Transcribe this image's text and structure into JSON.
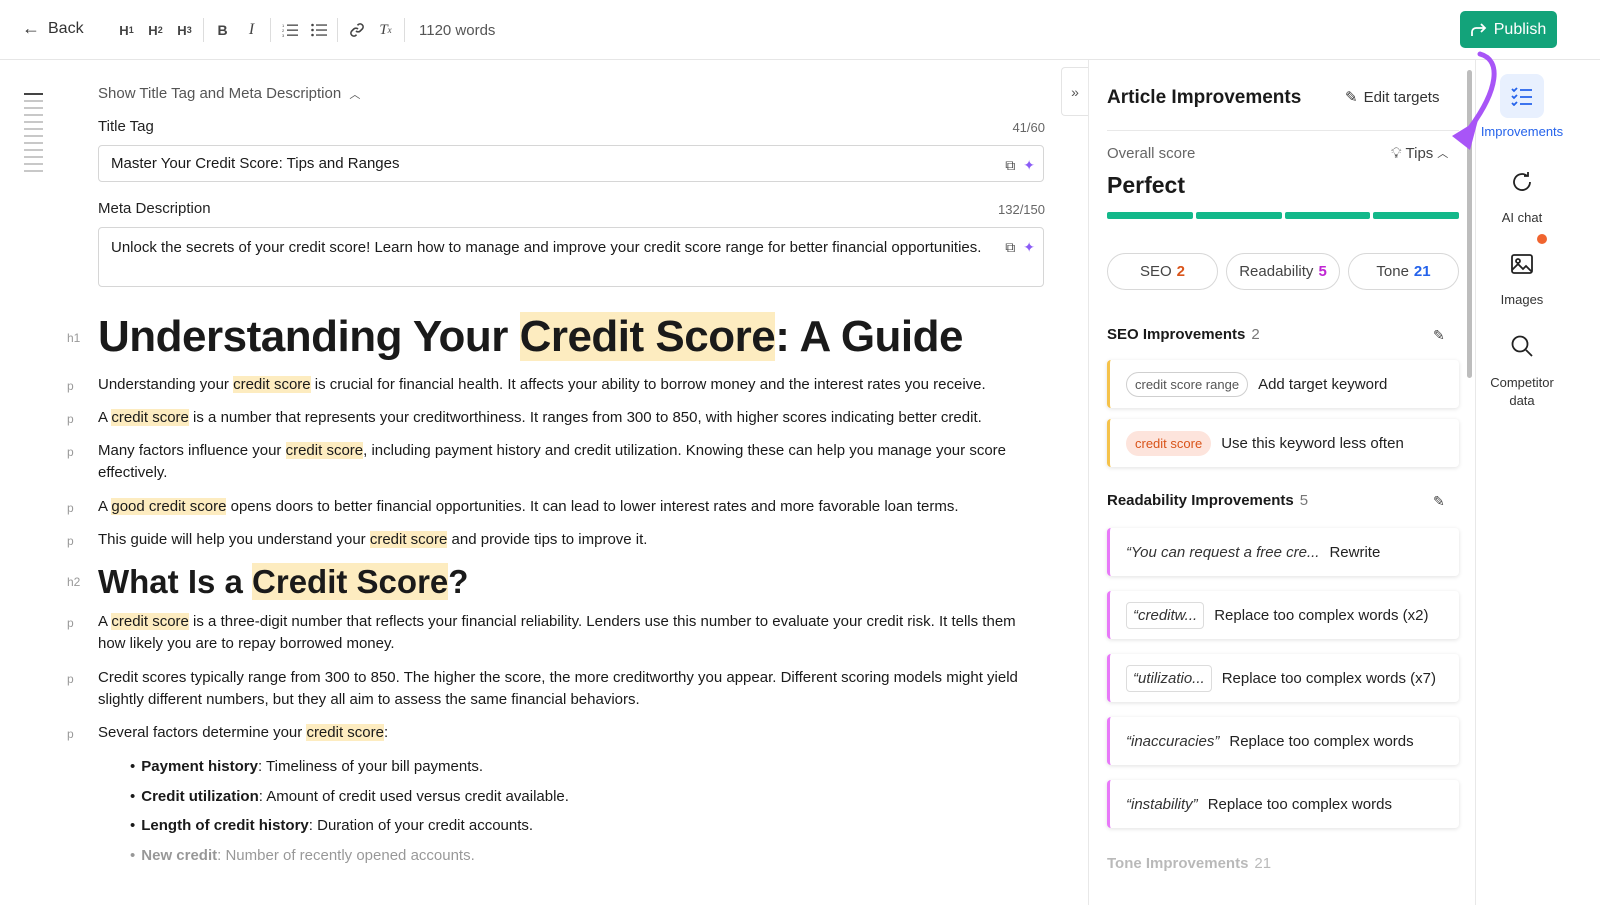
{
  "toolbar": {
    "back_label": "Back",
    "word_count": "1120 words",
    "publish_label": "Publish"
  },
  "meta": {
    "toggle_label": "Show Title Tag and Meta Description",
    "title_tag_label": "Title Tag",
    "title_tag_count": "41/60",
    "title_tag_value": "Master Your Credit Score: Tips and Ranges",
    "meta_desc_label": "Meta Description",
    "meta_desc_count": "132/150",
    "meta_desc_value": "Unlock the secrets of your credit score! Learn how to manage and improve your credit score range for better financial opportunities."
  },
  "doc": {
    "h1": {
      "tag": "h1",
      "before": "Understanding Your ",
      "hl": "Credit Score",
      "after": ": A Guide"
    },
    "p1": {
      "tag": "p",
      "before": "Understanding your ",
      "hl": "credit score",
      "after": " is crucial for financial health. It affects your ability to borrow money and the interest rates you receive."
    },
    "p2": {
      "tag": "p",
      "before": "A ",
      "hl": "credit score",
      "after": " is a number that represents your creditworthiness. It ranges from 300 to 850, with higher scores indicating better credit."
    },
    "p3": {
      "tag": "p",
      "before": "Many factors influence your ",
      "hl": "credit score",
      "after": ", including payment history and credit utilization. Knowing these can help you manage your score effectively."
    },
    "p4": {
      "tag": "p",
      "before": "A ",
      "hl": "good credit score",
      "after": " opens doors to better financial opportunities. It can lead to lower interest rates and more favorable loan terms."
    },
    "p5": {
      "tag": "p",
      "before": "This guide will help you understand your ",
      "hl": "credit score",
      "after": " and provide tips to improve it."
    },
    "h2": {
      "tag": "h2",
      "before": "What Is a ",
      "hl": "Credit Score",
      "after": "?"
    },
    "p6": {
      "tag": "p",
      "before": "A ",
      "hl": "credit score",
      "after": " is a three-digit number that reflects your financial reliability. Lenders use this number to evaluate your credit risk. It tells them how likely you are to repay borrowed money."
    },
    "p7": {
      "tag": "p",
      "text": "Credit scores typically range from 300 to 850. The higher the score, the more creditworthy you appear. Different scoring models might yield slightly different numbers, but they all aim to assess the same financial behaviors."
    },
    "p8": {
      "tag": "p",
      "before": "Several factors determine your ",
      "hl": "credit score",
      "after": ":"
    },
    "bullets": [
      {
        "bold": "Payment history",
        "rest": ": Timeliness of your bill payments."
      },
      {
        "bold": "Credit utilization",
        "rest": ": Amount of credit used versus credit available."
      },
      {
        "bold": "Length of credit history",
        "rest": ": Duration of your credit accounts."
      },
      {
        "bold": "New credit",
        "rest": ": Number of recently opened accounts."
      }
    ]
  },
  "panel": {
    "title": "Article Improvements",
    "edit_targets": "Edit targets",
    "overall_label": "Overall score",
    "tips_label": "Tips",
    "score_word": "Perfect",
    "score_fraction": 1.0,
    "pills": [
      {
        "label": "SEO",
        "count": "2"
      },
      {
        "label": "Readability",
        "count": "5"
      },
      {
        "label": "Tone",
        "count": "21"
      }
    ],
    "seo": {
      "title": "SEO Improvements",
      "count": "2",
      "items": [
        {
          "chip": "credit score range",
          "action": "Add target keyword"
        },
        {
          "chip": "credit score",
          "action": "Use this keyword less often"
        }
      ]
    },
    "readability": {
      "title": "Readability Improvements",
      "count": "5",
      "items": [
        {
          "quote": "“You can request a free cre...",
          "action": "Rewrite"
        },
        {
          "quote": "“creditw...",
          "action": "Replace too complex words  (x2)"
        },
        {
          "quote": "“utilizatio...",
          "action": "Replace too complex words  (x7)"
        },
        {
          "quote": "“inaccuracies”",
          "action": "Replace too complex words"
        },
        {
          "quote": "“instability”",
          "action": "Replace too complex words"
        }
      ]
    },
    "tone": {
      "title": "Tone Improvements",
      "count": "21"
    }
  },
  "rail": {
    "improvements": "Improvements",
    "ai_chat": "AI chat",
    "images": "Images",
    "competitor": "Competitor data"
  },
  "colors": {
    "publish": "#13a37a",
    "score_bar": "#13b88a",
    "keyword_highlight": "#fdecc0",
    "seo_accent": "#f5c24a",
    "readability_accent": "#e879f9",
    "annotation_arrow": "#a855f7"
  }
}
